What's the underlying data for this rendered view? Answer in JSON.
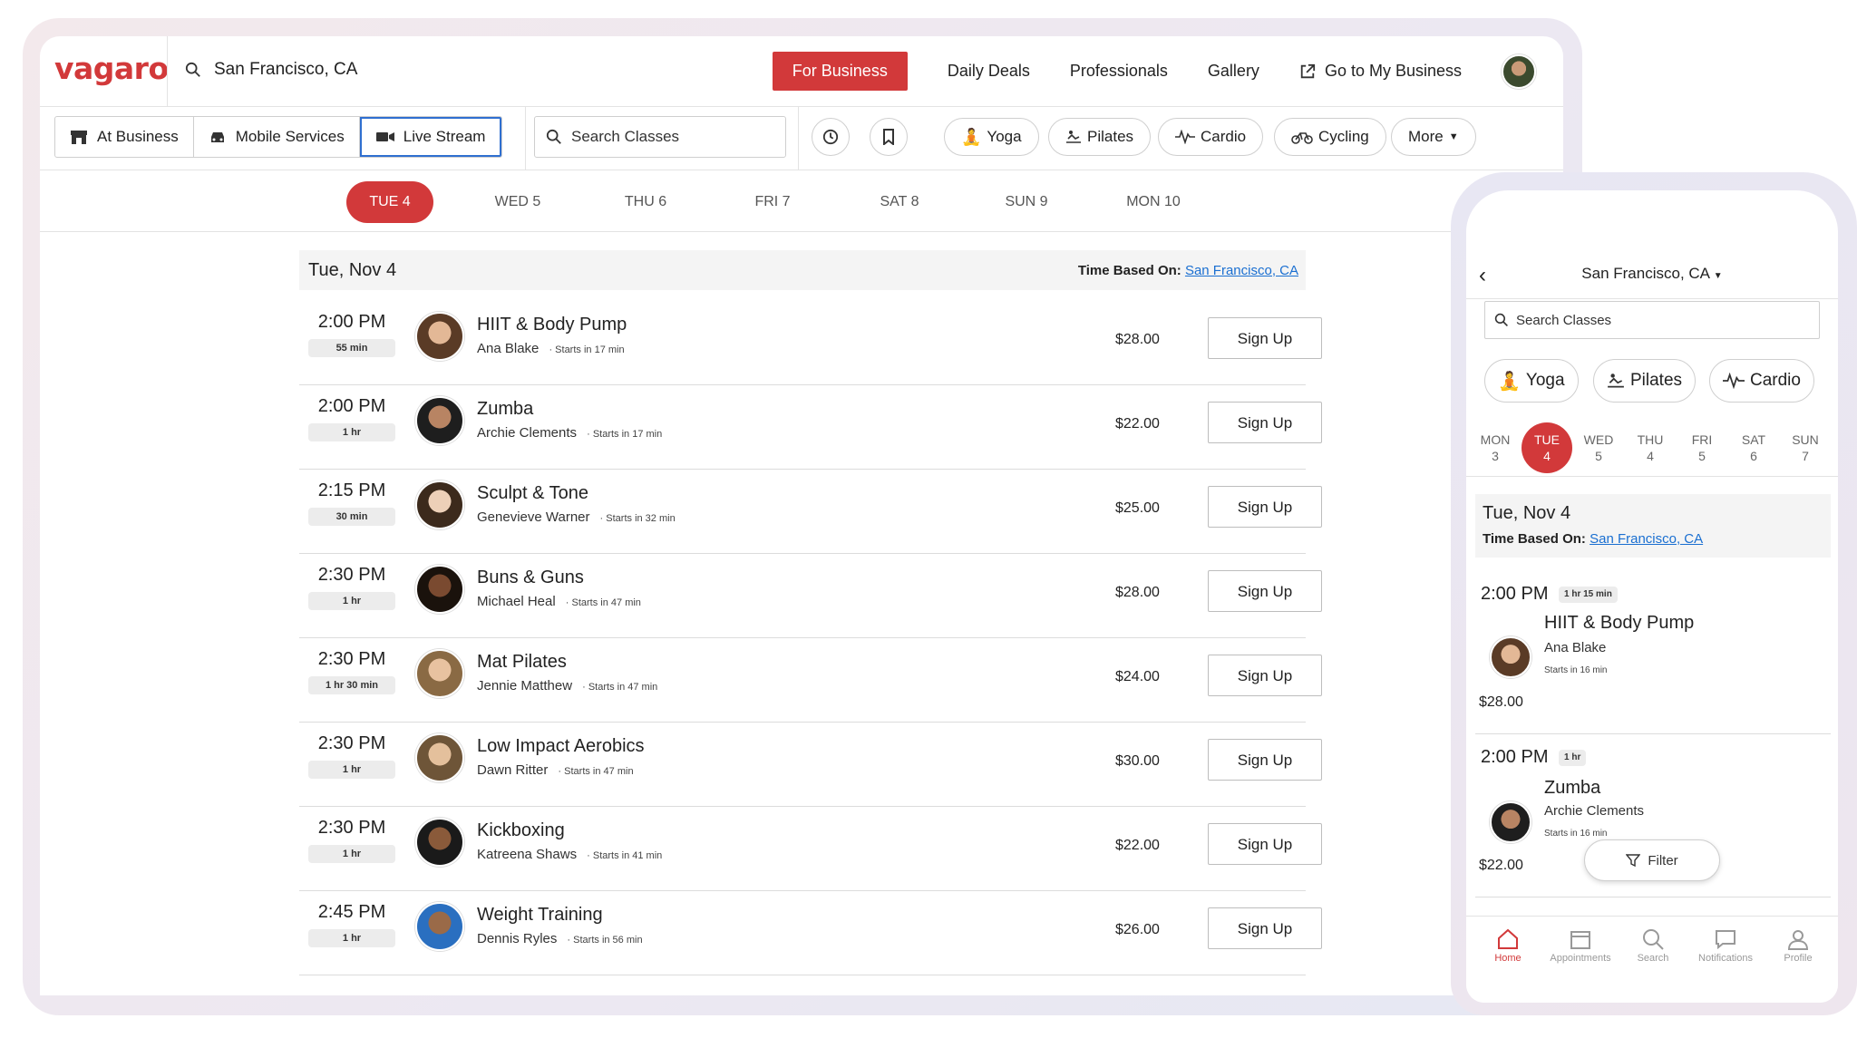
{
  "desktop": {
    "logo": "vagaro",
    "location": "San Francisco, CA",
    "nav": {
      "for_business": "For Business",
      "daily_deals": "Daily Deals",
      "professionals": "Professionals",
      "gallery": "Gallery",
      "go_to_business": "Go to My Business"
    },
    "modes": [
      "At Business",
      "Mobile Services",
      "Live Stream"
    ],
    "active_mode": "Live Stream",
    "search_placeholder": "Search Classes",
    "categories": [
      "Yoga",
      "Pilates",
      "Cardio",
      "Cycling"
    ],
    "more_label": "More",
    "days": [
      "TUE 4",
      "WED 5",
      "THU 6",
      "FRI 7",
      "SAT 8",
      "SUN 9",
      "MON 10"
    ],
    "active_day": "TUE 4",
    "date_header": "Tue, Nov 4",
    "time_based_label": "Time Based On:",
    "time_based_location": "San Francisco, CA",
    "classes": [
      {
        "time": "2:00 PM",
        "duration": "55 min",
        "name": "HIIT & Body Pump",
        "instructor": "Ana Blake",
        "starts": "Starts in 17 min",
        "price": "$28.00",
        "cta": "Sign Up"
      },
      {
        "time": "2:00 PM",
        "duration": "1 hr",
        "name": "Zumba",
        "instructor": "Archie Clements",
        "starts": "Starts in 17 min",
        "price": "$22.00",
        "cta": "Sign Up"
      },
      {
        "time": "2:15 PM",
        "duration": "30 min",
        "name": "Sculpt & Tone",
        "instructor": "Genevieve Warner",
        "starts": "Starts in 32 min",
        "price": "$25.00",
        "cta": "Sign Up"
      },
      {
        "time": "2:30 PM",
        "duration": "1 hr",
        "name": "Buns & Guns",
        "instructor": "Michael Heal",
        "starts": "Starts in 47 min",
        "price": "$28.00",
        "cta": "Sign Up"
      },
      {
        "time": "2:30 PM",
        "duration": "1 hr 30 min",
        "name": "Mat Pilates",
        "instructor": "Jennie Matthew",
        "starts": "Starts in 47 min",
        "price": "$24.00",
        "cta": "Sign Up"
      },
      {
        "time": "2:30 PM",
        "duration": "1 hr",
        "name": "Low Impact Aerobics",
        "instructor": "Dawn Ritter",
        "starts": "Starts in 47 min",
        "price": "$30.00",
        "cta": "Sign Up"
      },
      {
        "time": "2:30 PM",
        "duration": "1 hr",
        "name": "Kickboxing",
        "instructor": "Katreena Shaws",
        "starts": "Starts in 41 min",
        "price": "$22.00",
        "cta": "Sign Up"
      },
      {
        "time": "2:45 PM",
        "duration": "1 hr",
        "name": "Weight Training",
        "instructor": "Dennis Ryles",
        "starts": "Starts in 56 min",
        "price": "$26.00",
        "cta": "Sign Up"
      }
    ]
  },
  "mobile": {
    "location": "San Francisco, CA",
    "search_placeholder": "Search Classes",
    "categories": [
      "Yoga",
      "Pilates",
      "Cardio"
    ],
    "days": [
      {
        "dow": "MON",
        "num": "3"
      },
      {
        "dow": "TUE",
        "num": "4"
      },
      {
        "dow": "WED",
        "num": "5"
      },
      {
        "dow": "THU",
        "num": "4"
      },
      {
        "dow": "FRI",
        "num": "5"
      },
      {
        "dow": "SAT",
        "num": "6"
      },
      {
        "dow": "SUN",
        "num": "7"
      }
    ],
    "date_header": "Tue, Nov 4",
    "time_based_label": "Time Based On:",
    "time_based_location": "San Francisco, CA",
    "classes": [
      {
        "time": "2:00 PM",
        "duration": "1 hr 15 min",
        "name": "HIIT & Body Pump",
        "instructor": "Ana Blake",
        "starts": "Starts in 16 min",
        "price": "$28.00"
      },
      {
        "time": "2:00 PM",
        "duration": "1 hr",
        "name": "Zumba",
        "instructor": "Archie Clements",
        "starts": "Starts in 16 min",
        "price": "$22.00"
      }
    ],
    "filter_label": "Filter",
    "tabs": [
      "Home",
      "Appointments",
      "Search",
      "Notifications",
      "Profile"
    ],
    "active_tab": "Home"
  },
  "colors": {
    "brand_red": "#d2393a",
    "link_blue": "#1a6fd1",
    "active_border": "#2f6fd0"
  }
}
